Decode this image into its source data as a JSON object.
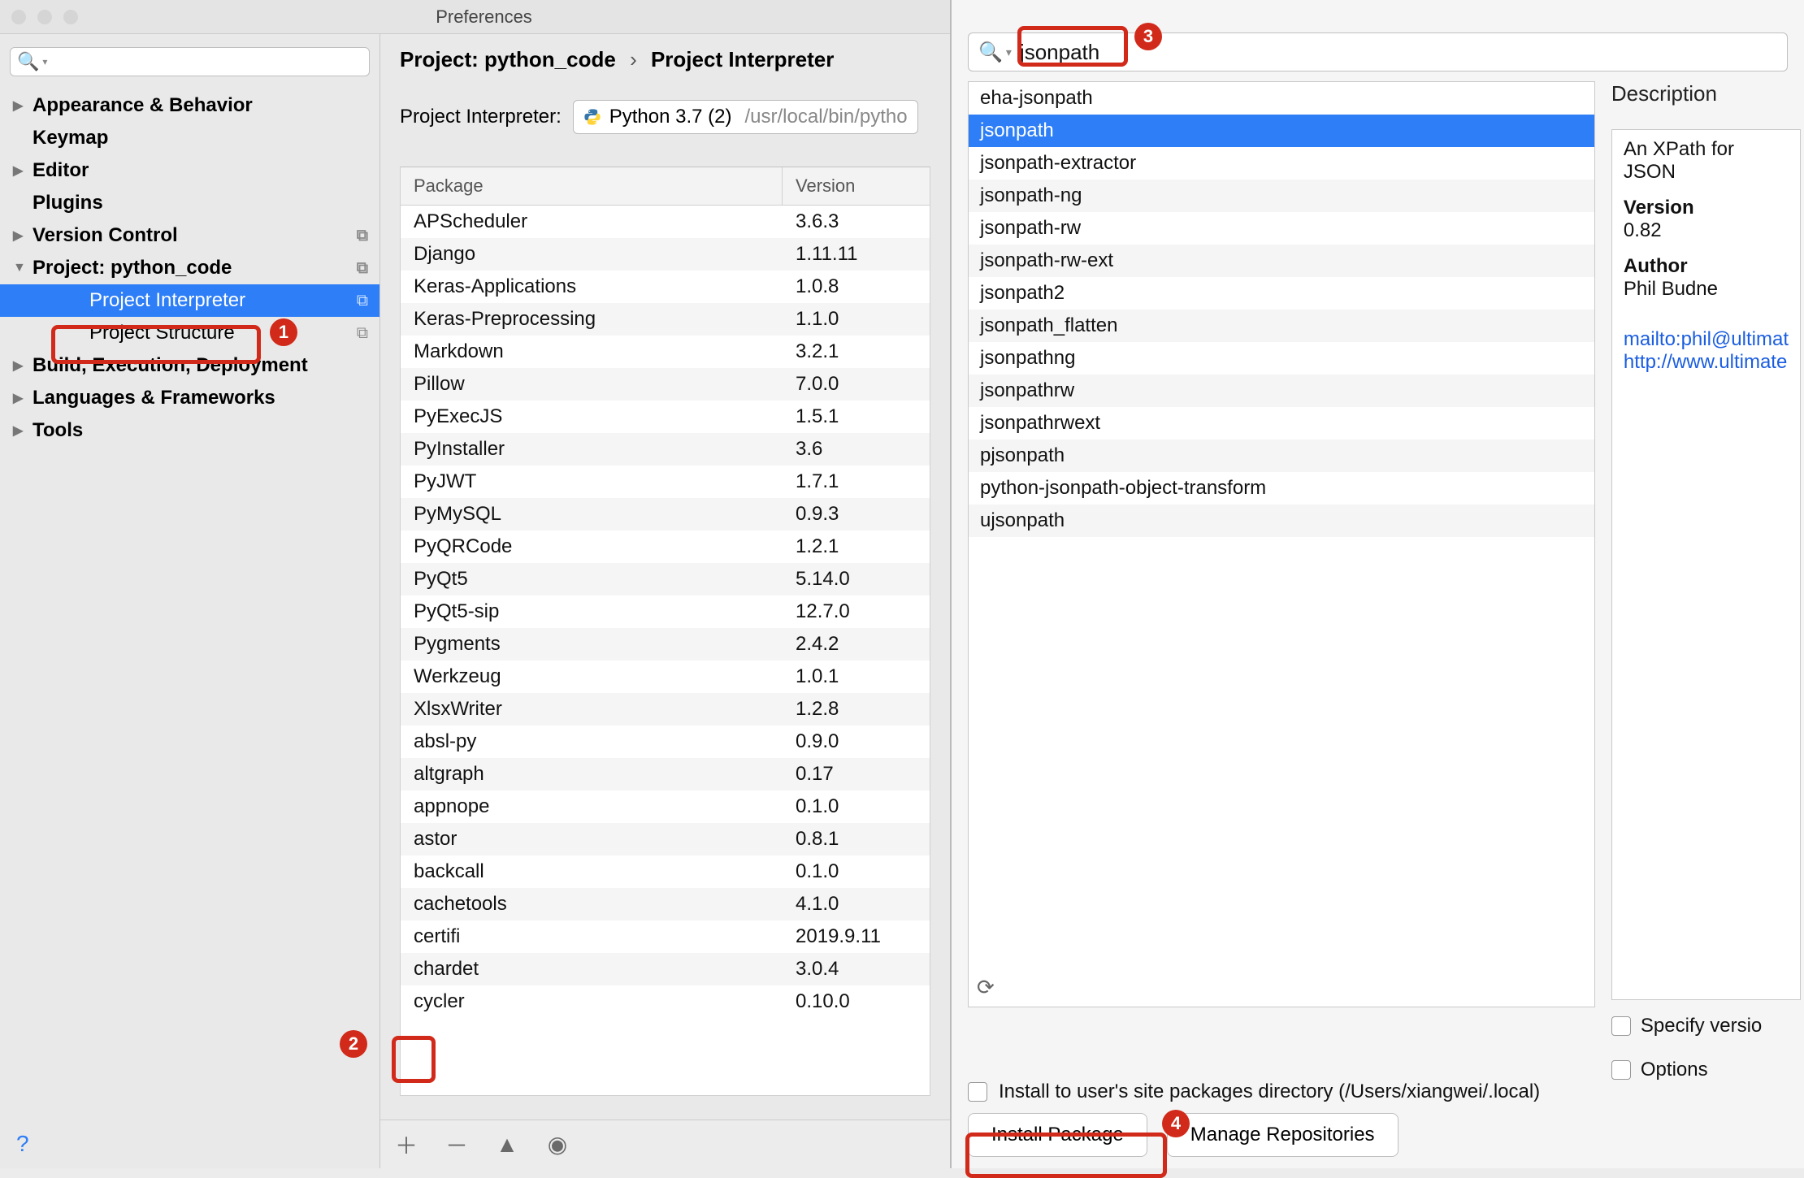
{
  "window": {
    "title": "Preferences"
  },
  "sidebar": {
    "search_placeholder": "",
    "items": [
      {
        "label": "Appearance & Behavior",
        "bold": true,
        "tri": "▶"
      },
      {
        "label": "Keymap",
        "bold": true
      },
      {
        "label": "Editor",
        "bold": true,
        "tri": "▶"
      },
      {
        "label": "Plugins",
        "bold": true
      },
      {
        "label": "Version Control",
        "bold": true,
        "tri": "▶",
        "copy": true
      },
      {
        "label": "Project: python_code",
        "bold": true,
        "tri": "▼",
        "copy": true
      },
      {
        "label": "Project Interpreter",
        "indent": 2,
        "selected": true,
        "copy": true
      },
      {
        "label": "Project Structure",
        "indent": 2,
        "copy": true
      },
      {
        "label": "Build, Execution, Deployment",
        "bold": true,
        "tri": "▶"
      },
      {
        "label": "Languages & Frameworks",
        "bold": true,
        "tri": "▶"
      },
      {
        "label": "Tools",
        "bold": true,
        "tri": "▶"
      }
    ]
  },
  "breadcrumb": {
    "a": "Project: python_code",
    "b": "Project Interpreter"
  },
  "interpreter": {
    "label": "Project Interpreter:",
    "value": "Python 3.7 (2)",
    "path": "/usr/local/bin/pytho"
  },
  "pkg_headers": {
    "pkg": "Package",
    "ver": "Version"
  },
  "packages": [
    {
      "name": "APScheduler",
      "version": "3.6.3"
    },
    {
      "name": "Django",
      "version": "1.11.11"
    },
    {
      "name": "Keras-Applications",
      "version": "1.0.8"
    },
    {
      "name": "Keras-Preprocessing",
      "version": "1.1.0"
    },
    {
      "name": "Markdown",
      "version": "3.2.1"
    },
    {
      "name": "Pillow",
      "version": "7.0.0"
    },
    {
      "name": "PyExecJS",
      "version": "1.5.1"
    },
    {
      "name": "PyInstaller",
      "version": "3.6"
    },
    {
      "name": "PyJWT",
      "version": "1.7.1"
    },
    {
      "name": "PyMySQL",
      "version": "0.9.3"
    },
    {
      "name": "PyQRCode",
      "version": "1.2.1"
    },
    {
      "name": "PyQt5",
      "version": "5.14.0"
    },
    {
      "name": "PyQt5-sip",
      "version": "12.7.0"
    },
    {
      "name": "Pygments",
      "version": "2.4.2"
    },
    {
      "name": "Werkzeug",
      "version": "1.0.1"
    },
    {
      "name": "XlsxWriter",
      "version": "1.2.8"
    },
    {
      "name": "absl-py",
      "version": "0.9.0"
    },
    {
      "name": "altgraph",
      "version": "0.17"
    },
    {
      "name": "appnope",
      "version": "0.1.0"
    },
    {
      "name": "astor",
      "version": "0.8.1"
    },
    {
      "name": "backcall",
      "version": "0.1.0"
    },
    {
      "name": "cachetools",
      "version": "4.1.0"
    },
    {
      "name": "certifi",
      "version": "2019.9.11"
    },
    {
      "name": "chardet",
      "version": "3.0.4"
    },
    {
      "name": "cycler",
      "version": "0.10.0"
    }
  ],
  "avail": {
    "search_value": "jsonpath",
    "results": [
      "eha-jsonpath",
      "jsonpath",
      "jsonpath-extractor",
      "jsonpath-ng",
      "jsonpath-rw",
      "jsonpath-rw-ext",
      "jsonpath2",
      "jsonpath_flatten",
      "jsonpathng",
      "jsonpathrw",
      "jsonpathrwext",
      "pjsonpath",
      "python-jsonpath-object-transform",
      "ujsonpath"
    ],
    "selected_index": 1
  },
  "desc": {
    "title": "Description",
    "summary": "An XPath for JSON",
    "version_label": "Version",
    "version": "0.82",
    "author_label": "Author",
    "author": "Phil Budne",
    "link_mail": "mailto:phil@ultimat",
    "link_web": "http://www.ultimate",
    "specify_version": "Specify versio",
    "options": "Options"
  },
  "install": {
    "note": "Install to user's site packages directory (/Users/xiangwei/.local)",
    "install_btn": "Install Package",
    "manage_btn": "Manage Repositories"
  },
  "annotations": {
    "1": "1",
    "2": "2",
    "3": "3",
    "4": "4"
  }
}
